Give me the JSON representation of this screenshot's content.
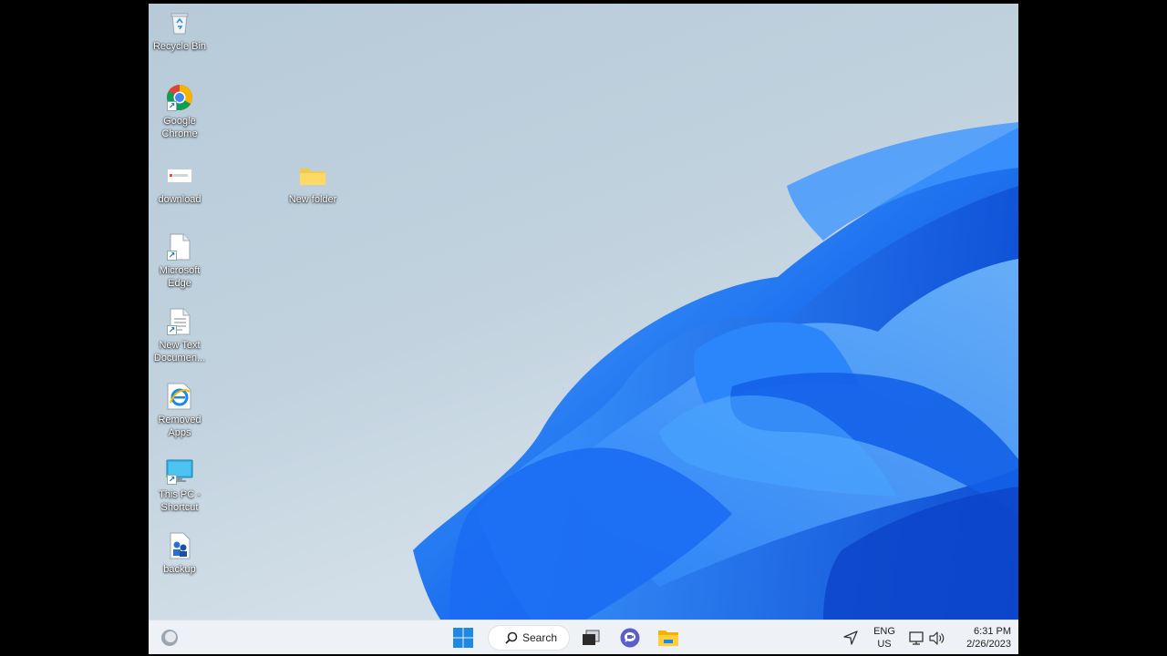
{
  "desktop": {
    "icons": [
      {
        "label": "Recycle Bin",
        "icon": "recycle-bin-icon"
      },
      {
        "label": "Google\nChrome",
        "icon": "chrome-icon"
      },
      {
        "label": "download",
        "icon": "image-file-icon"
      },
      {
        "label": "New folder",
        "icon": "folder-icon"
      },
      {
        "label": "Microsoft\nEdge",
        "icon": "blank-file-icon"
      },
      {
        "label": "New Text\nDocumen...",
        "icon": "text-document-icon"
      },
      {
        "label": "Removed\nApps",
        "icon": "internet-explorer-icon"
      },
      {
        "label": "This PC -\nShortcut",
        "icon": "monitor-icon"
      },
      {
        "label": "backup",
        "icon": "backup-file-icon"
      }
    ]
  },
  "taskbar": {
    "search_label": "Search",
    "language_line1": "ENG",
    "language_line2": "US",
    "time": "6:31 PM",
    "date": "2/26/2023",
    "icons": [
      "weather-icon",
      "start-icon",
      "search-icon",
      "task-view-icon",
      "chat-icon",
      "file-explorer-icon",
      "location-icon",
      "network-icon",
      "volume-icon"
    ]
  },
  "colors": {
    "accent": "#1a73e8",
    "taskbar_bg": "#eef1f5",
    "wallpaper_bloom": "#1e6ff0"
  }
}
